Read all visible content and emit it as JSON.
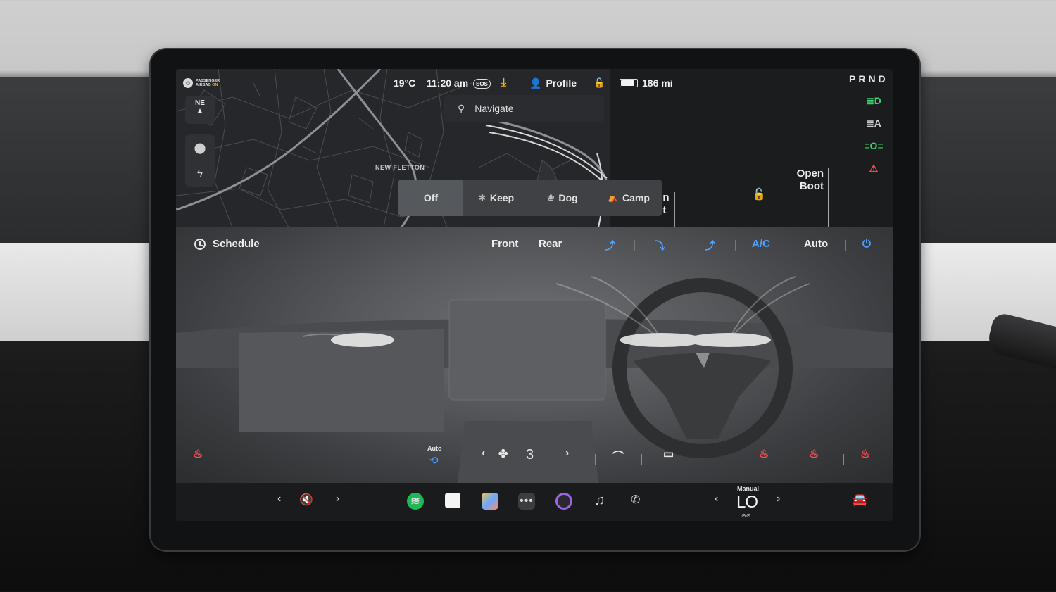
{
  "status": {
    "airbag_line1": "PASSENGER",
    "airbag_line2": "AIRBAG",
    "airbag_state": "ON",
    "temperature": "19°C",
    "time": "11:20 am",
    "sos": "SOS",
    "profile": "Profile",
    "range": "186 mi",
    "gear": "PRND"
  },
  "map": {
    "compass": "NE",
    "place_label": "NEW FLETTON",
    "search_placeholder": "Navigate"
  },
  "vehicle": {
    "open_boot": [
      "Open",
      "Boot"
    ],
    "frunk_partial": [
      "en",
      "et"
    ],
    "modes": [
      "Off",
      "Keep",
      "Dog",
      "Camp"
    ],
    "active_mode": "Off"
  },
  "indicators": {
    "headlights_color": "#3ad06a",
    "auto_lights_color": "#cfcfcf",
    "parking_lights_color": "#3ad06a",
    "seatbelt_color": "#ff4f4f"
  },
  "climate": {
    "schedule": "Schedule",
    "front": "Front",
    "rear": "Rear",
    "ac": "A/C",
    "auto": "Auto",
    "recirc_label": "Auto",
    "fan_speed": "3",
    "accent_color": "#4da3ff"
  },
  "dock": {
    "manual_label": "Manual",
    "temp_setting": "LO"
  }
}
